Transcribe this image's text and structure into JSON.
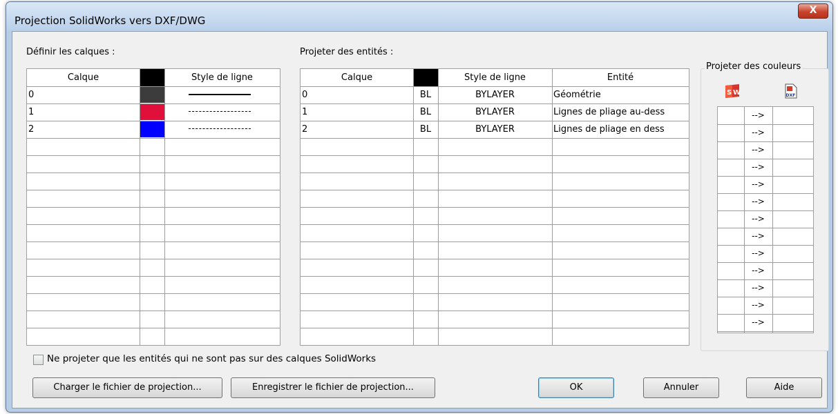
{
  "window": {
    "title": "Projection SolidWorks vers DXF/DWG",
    "close_label": "X"
  },
  "layers": {
    "label": "Définir les calques :",
    "headers": [
      "Calque",
      "",
      "Style de ligne"
    ],
    "rows": [
      {
        "name": "0",
        "color": "#3c3c3c",
        "linestyle": "solid"
      },
      {
        "name": "1",
        "color": "#e0103a",
        "linestyle": "dashdot"
      },
      {
        "name": "2",
        "color": "#0000ff",
        "linestyle": "dashdot"
      }
    ],
    "empty_rows": 12,
    "header_color": "#000000"
  },
  "entities": {
    "label": "Projeter des entités :",
    "headers": [
      "Calque",
      "",
      "Style de ligne",
      "Entité"
    ],
    "rows": [
      {
        "layer": "0",
        "color": "BL",
        "linestyle": "BYLAYER",
        "entity": "Géométrie"
      },
      {
        "layer": "1",
        "color": "BL",
        "linestyle": "BYLAYER",
        "entity": "Lignes de pliage au-dess"
      },
      {
        "layer": "2",
        "color": "BL",
        "linestyle": "BYLAYER",
        "entity": "Lignes de pliage en dess"
      }
    ],
    "empty_rows": 12
  },
  "colors": {
    "label": "Projeter des couleurs",
    "arrow": "-->",
    "rows": 13,
    "icons": [
      "solidworks-icon",
      "dxf-icon"
    ]
  },
  "checkbox": {
    "label": "Ne projeter que les entités qui ne sont pas sur des calques SolidWorks",
    "checked": false
  },
  "buttons": {
    "load": "Charger le fichier de projection...",
    "save": "Enregistrer le fichier de projection...",
    "ok": "OK",
    "cancel": "Annuler",
    "help": "Aide"
  }
}
